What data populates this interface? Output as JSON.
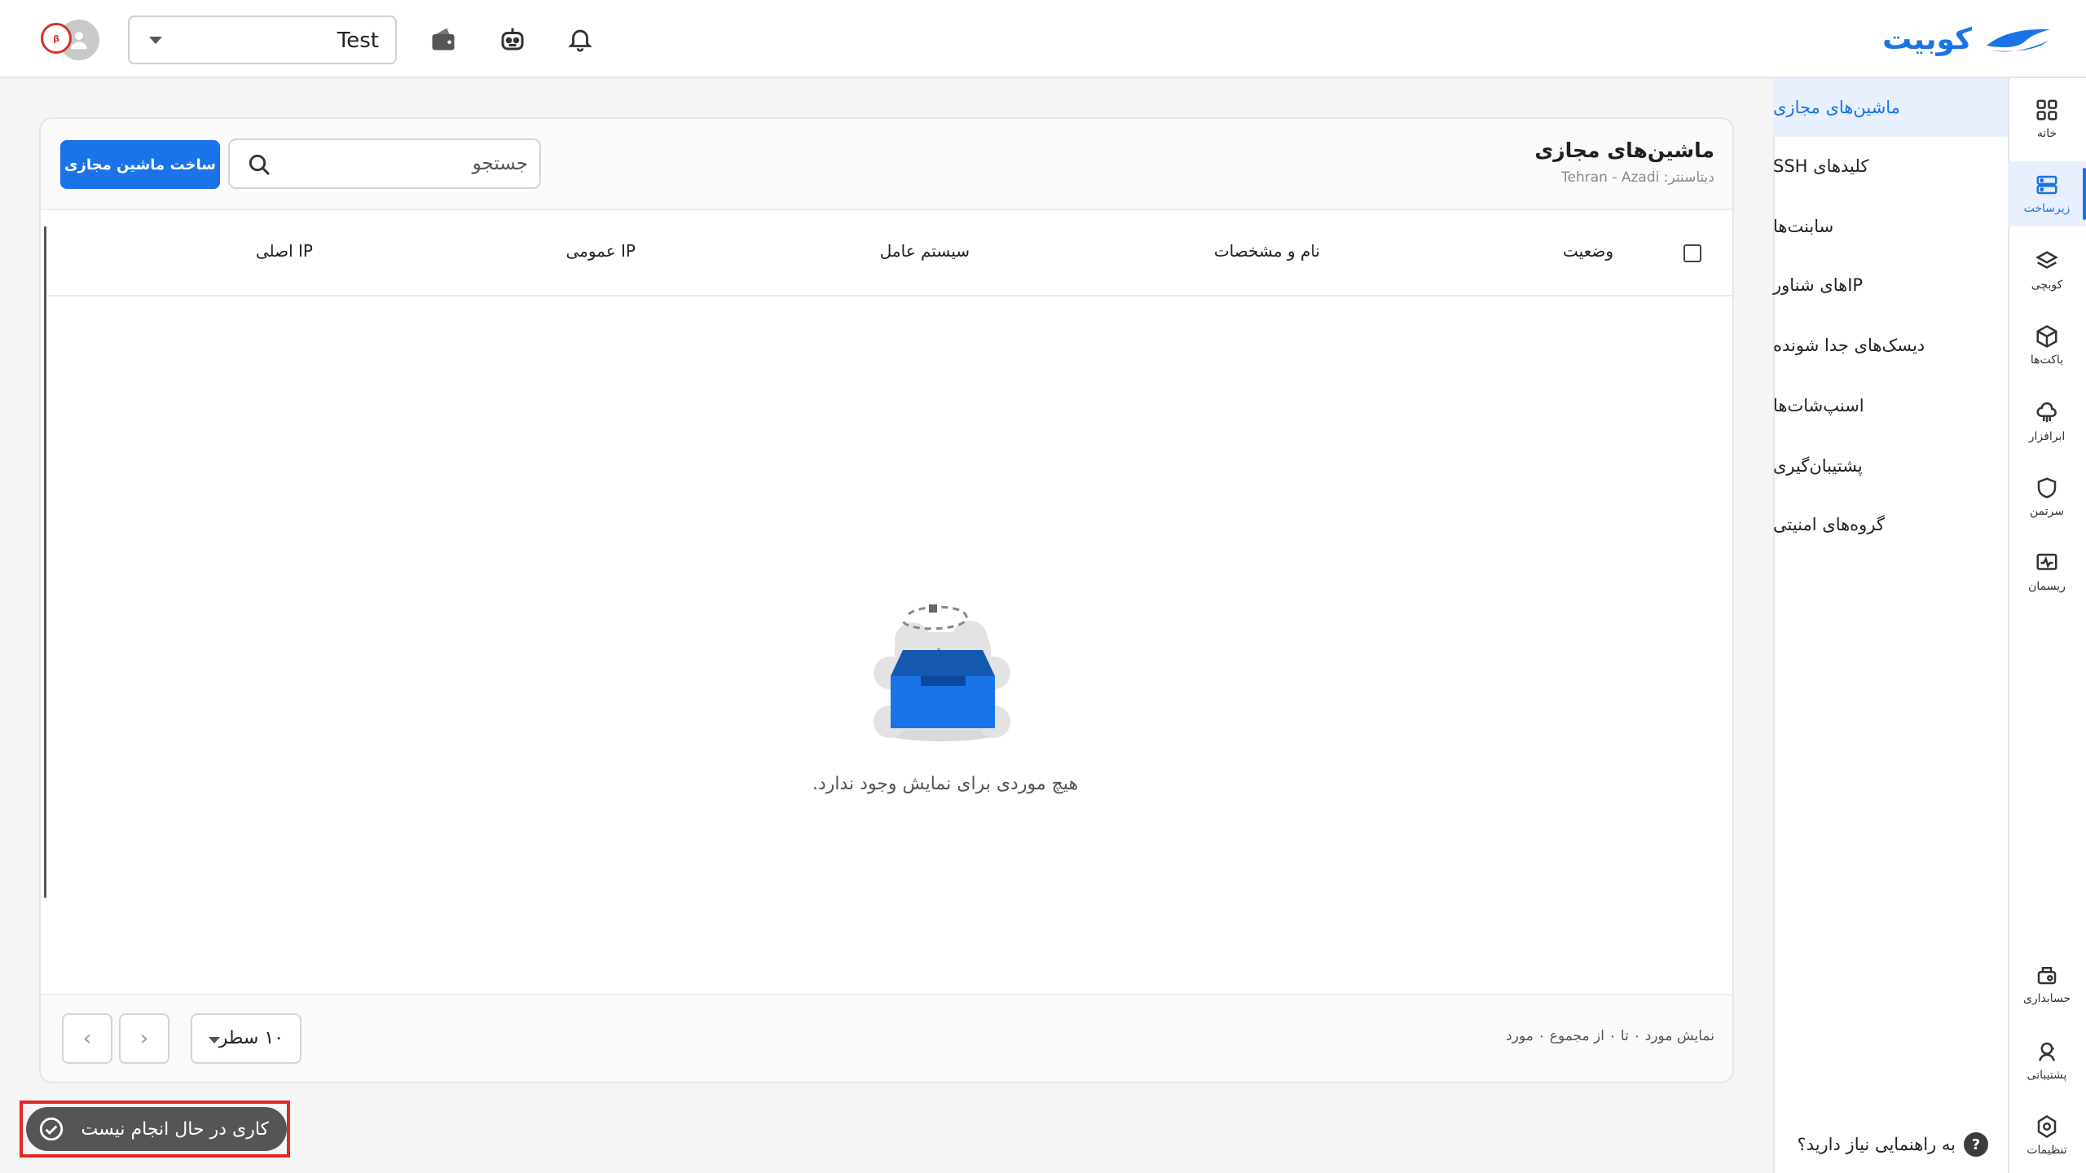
{
  "brand": {
    "logo_text": "کوبیت"
  },
  "header": {
    "project_value": "Test",
    "icons": [
      "wallet-icon",
      "robot-icon",
      "bell-icon",
      "user-icon"
    ]
  },
  "rail": {
    "items": [
      {
        "label": "خانه",
        "icon": "grid-icon"
      },
      {
        "label": "زیرساخت",
        "icon": "server-icon"
      },
      {
        "label": "کوبچی",
        "icon": "layers-icon"
      },
      {
        "label": "باکت‌ها",
        "icon": "cube-icon"
      },
      {
        "label": "ابرافزار",
        "icon": "cloud-icon"
      },
      {
        "label": "سرتمن",
        "icon": "shield-icon"
      },
      {
        "label": "ریسمان",
        "icon": "monitor-icon"
      },
      {
        "label": "حسابداری",
        "icon": "accounting-icon"
      },
      {
        "label": "پشتیبانی",
        "icon": "support-icon"
      },
      {
        "label": "تنظیمات",
        "icon": "settings-icon"
      }
    ]
  },
  "subnav": {
    "items": [
      {
        "label": "ماشین‌های مجازی"
      },
      {
        "label": "کلیدهای SSH"
      },
      {
        "label": "سابنت‌ها"
      },
      {
        "label": "IPهای شناور"
      },
      {
        "label": "دیسک‌های جدا شونده"
      },
      {
        "label": "اسنپ‌شات‌ها"
      },
      {
        "label": "پشتیبان‌گیری"
      },
      {
        "label": "گروه‌های امنیتی"
      }
    ],
    "help": "به راهنمایی نیاز دارید؟"
  },
  "main": {
    "title": "ماشین‌های مجازی",
    "subtitle": "دیتاسنتر: Tehran - Azadi",
    "search_placeholder": "جستجو",
    "create_button": "ساخت ماشین مجازی",
    "columns": {
      "status": "وضعیت",
      "name": "نام و مشخصات",
      "os": "سیستم عامل",
      "public_ip": "IP عمومی",
      "private_ip": "IP اصلی"
    },
    "empty_text": "هیچ موردی برای نمایش وجود ندارد.",
    "footer": {
      "range_text": "نمایش مورد ۰ تا ۰ از مجموع ۰ مورد",
      "rows_value": "۱۰ سطر",
      "next_symbol": "›",
      "prev_symbol": "‹"
    }
  },
  "status_toast": {
    "text": "کاری در حال انجام نیست"
  },
  "colors": {
    "accent": "#1a73e8",
    "toast_bg": "#555555",
    "highlight_border": "#e3262b"
  }
}
